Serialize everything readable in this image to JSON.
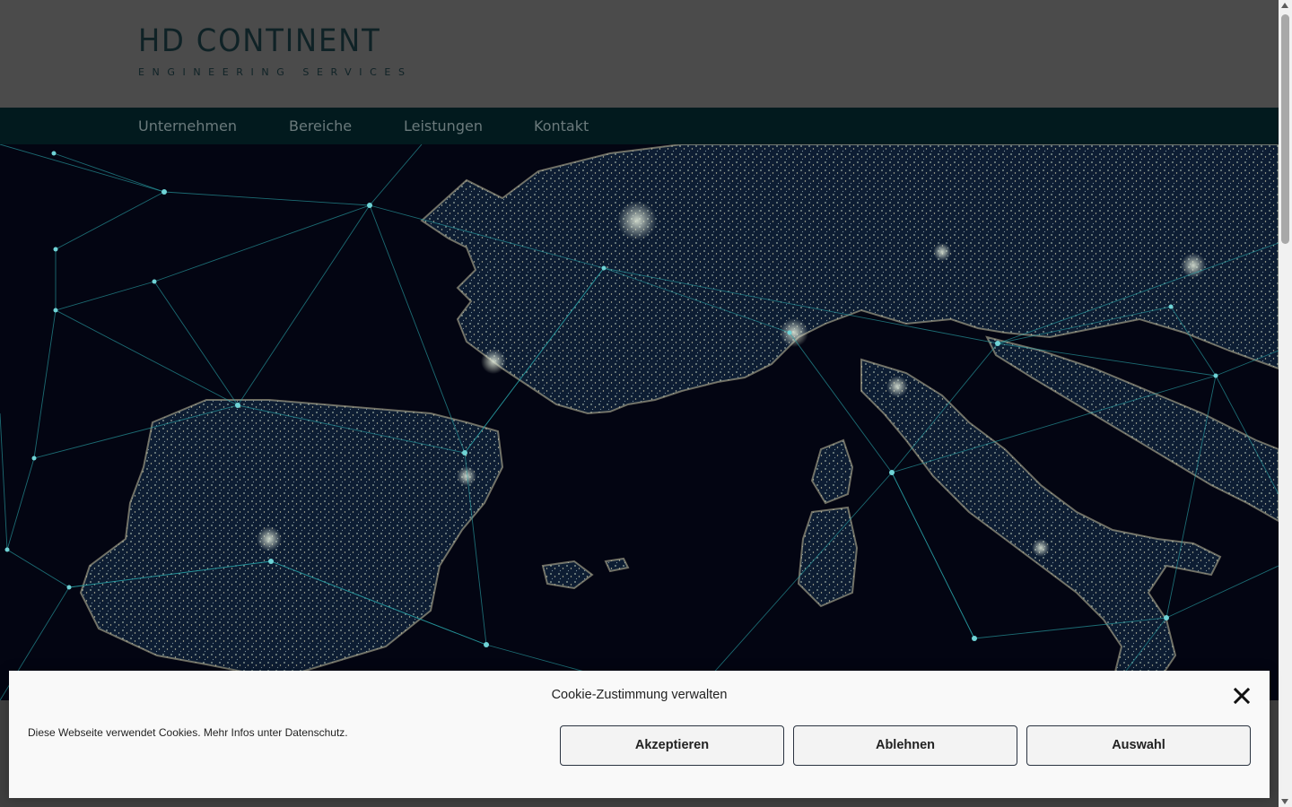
{
  "logo": {
    "title": "HD CONTINENT",
    "subtitle": "ENGINEERING SERVICES"
  },
  "nav": {
    "items": [
      "Unternehmen",
      "Bereiche",
      "Leistungen",
      "Kontakt"
    ]
  },
  "hero": {
    "image": "night-satellite-map-europe-network"
  },
  "cookie": {
    "title": "Cookie-Zustimmung verwalten",
    "text": "Diese Webseite verwendet Cookies. Mehr Infos unter Datenschutz.",
    "accept_label": "Akzeptieren",
    "deny_label": "Ablehnen",
    "choose_label": "Auswahl",
    "close_icon": "close-icon"
  },
  "colors": {
    "header_bg": "#4b4b4b",
    "nav_bg": "#021a1e",
    "nav_text": "#6b7a7c",
    "hero_bg": "#030512",
    "network_line": "#2aa3a8",
    "land_lights": "#d8d0b0",
    "cookie_bg": "#f9f9f9"
  }
}
